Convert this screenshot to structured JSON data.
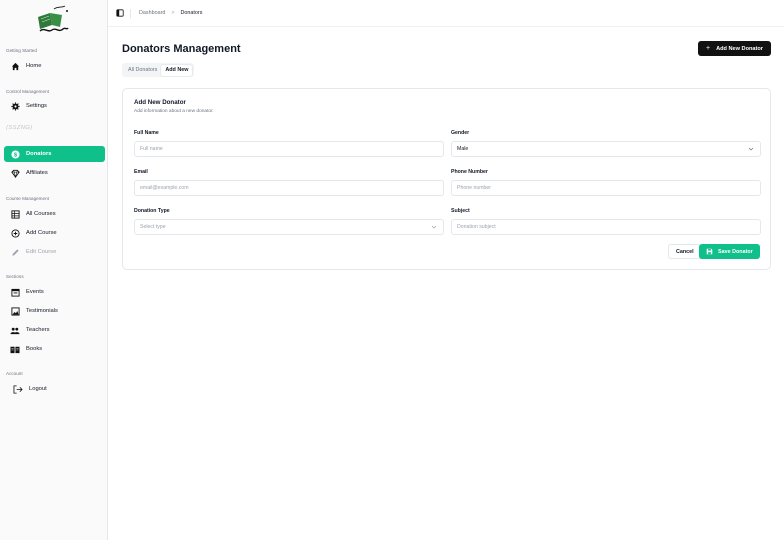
{
  "colors": {
    "accent": "#10c08a",
    "dark_button": "#111111"
  },
  "sidebar": {
    "logo_alt": "logo",
    "sections": [
      {
        "label": "Getting Started"
      },
      {
        "label": "Control Management"
      },
      {
        "label": "Course Management"
      },
      {
        "label": "Sections"
      },
      {
        "label": "Account"
      }
    ],
    "items": [
      {
        "label": "Home",
        "icon": "home-icon"
      },
      {
        "label": "Settings",
        "icon": "gear-icon"
      },
      {
        "label": "(SSZNG)",
        "icon": "none"
      },
      {
        "label": "Donators",
        "icon": "dollar-icon",
        "active": true
      },
      {
        "label": "Affiliates",
        "icon": "diamond-icon"
      },
      {
        "label": "All Courses",
        "icon": "grid-icon"
      },
      {
        "label": "Add Course",
        "icon": "plus-circle-icon"
      },
      {
        "label": "Edit Course",
        "icon": "pencil-icon",
        "disabled": true
      },
      {
        "label": "Events",
        "icon": "calendar-icon"
      },
      {
        "label": "Testimonials",
        "icon": "image-icon"
      },
      {
        "label": "Teachers",
        "icon": "people-icon"
      },
      {
        "label": "Books",
        "icon": "book-icon"
      },
      {
        "label": "Logout",
        "icon": "logout-icon"
      }
    ]
  },
  "breadcrumb": {
    "root": "Dashboard",
    "separator": ">",
    "current": "Donators"
  },
  "page": {
    "title": "Donators Management",
    "add_button": "Add New Donator"
  },
  "tabs": [
    {
      "label": "All Donators",
      "active": false
    },
    {
      "label": "Add New",
      "active": true
    }
  ],
  "form": {
    "title": "Add New Donator",
    "subtitle": "Add information about a new donator.",
    "fields": {
      "full_name": {
        "label": "Full Name",
        "placeholder": "Full name"
      },
      "gender": {
        "label": "Gender",
        "value": "Male"
      },
      "email": {
        "label": "Email",
        "placeholder": "email@example.com"
      },
      "phone": {
        "label": "Phone Number",
        "placeholder": "Phone number"
      },
      "donation_type": {
        "label": "Donation Type",
        "placeholder": "Select type"
      },
      "subject": {
        "label": "Subject",
        "placeholder": "Donation subject"
      }
    },
    "cancel_label": "Cancel",
    "save_label": "Save Donator"
  }
}
